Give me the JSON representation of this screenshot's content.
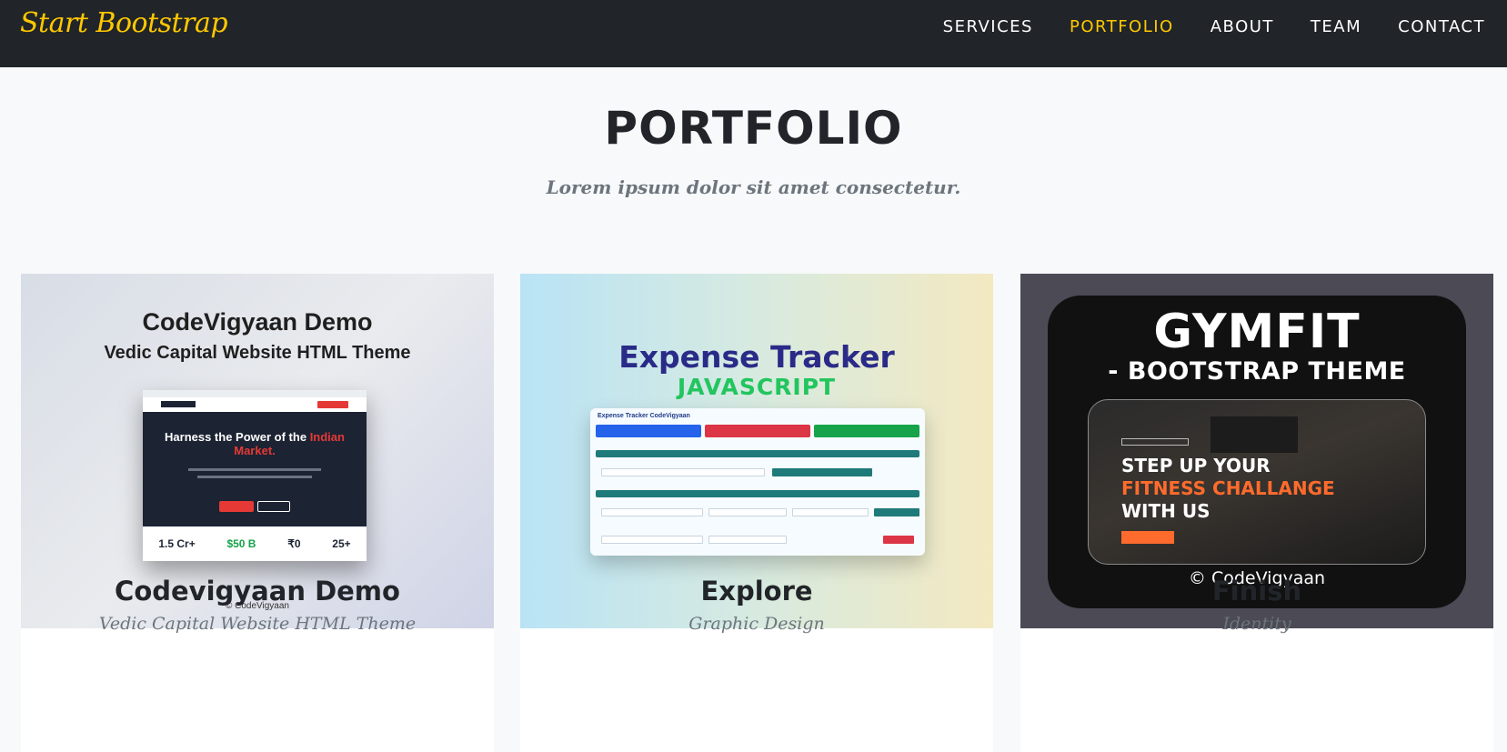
{
  "navbar": {
    "brand": "Start Bootstrap",
    "links": [
      "SERVICES",
      "PORTFOLIO",
      "ABOUT",
      "TEAM",
      "CONTACT"
    ],
    "active": "PORTFOLIO",
    "accent_color": "#ffc800",
    "background": "#212529"
  },
  "section": {
    "heading": "PORTFOLIO",
    "subheading": "Lorem ipsum dolor sit amet consectetur."
  },
  "portfolio_items": [
    {
      "title": "Codevigyaan Demo",
      "subtitle": "Vedic Capital Website HTML Theme",
      "thumbnail": {
        "title": "CodeVigyaan Demo",
        "subtitle": "Vedic Capital Website HTML Theme",
        "hero_text": "Harness the Power of the",
        "hero_highlight": "Indian Market.",
        "stats": [
          "1.5 Cr+",
          "$50 B",
          "₹0",
          "25+"
        ],
        "footer": "© CodeVigyaan"
      }
    },
    {
      "title": "Explore",
      "subtitle": "Graphic Design",
      "thumbnail": {
        "title": "Expense Tracker",
        "subtitle": "JAVASCRIPT",
        "app_title": "Expense Tracker CodeVigyaan"
      }
    },
    {
      "title": "Finish",
      "subtitle": "Identity",
      "thumbnail": {
        "title": "GYMFIT",
        "subtitle": "- BOOTSTRAP THEME",
        "hero_line1": "STEP UP YOUR",
        "hero_line2": "FITNESS CHALLANGE",
        "hero_line3": "WITH US",
        "footer": "© CodeVigyaan"
      }
    }
  ]
}
